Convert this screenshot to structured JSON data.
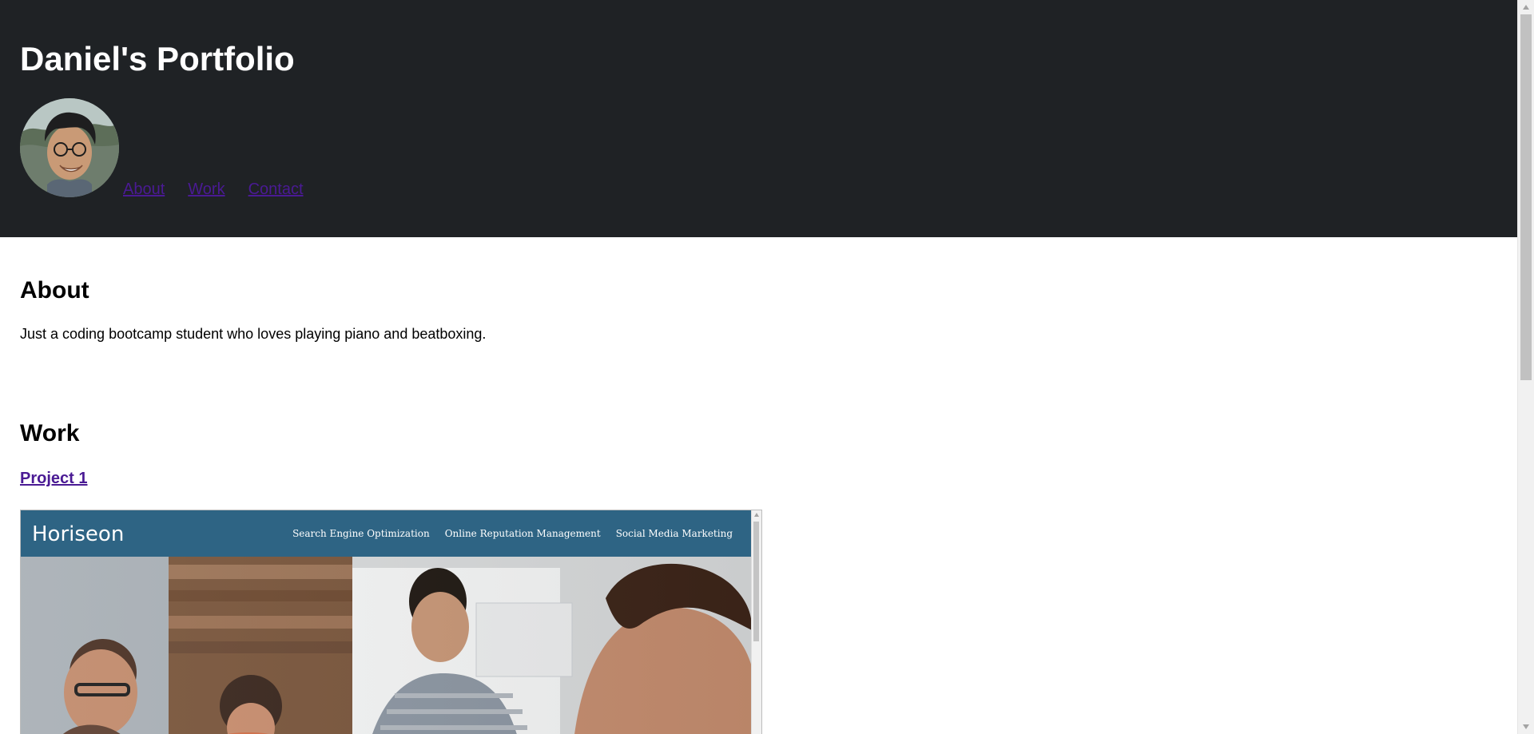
{
  "header": {
    "title": "Daniel's Portfolio",
    "background": "#1f2225"
  },
  "nav": {
    "items": [
      {
        "label": "About"
      },
      {
        "label": "Work"
      },
      {
        "label": "Contact"
      }
    ],
    "link_color": "#4a1a94"
  },
  "about": {
    "heading": "About",
    "text": "Just a coding bootcamp student who loves playing piano and beatboxing."
  },
  "work": {
    "heading": "Work",
    "projects": [
      {
        "title": "Project 1",
        "screenshot": {
          "brand": "Horiseon",
          "nav": [
            "Search Engine Optimization",
            "Online Reputation Management",
            "Social Media Marketing"
          ],
          "header_color": "#2e6484"
        }
      }
    ]
  },
  "icons": {
    "avatar": "profile-photo",
    "scrollbar": "vertical-scrollbar"
  }
}
